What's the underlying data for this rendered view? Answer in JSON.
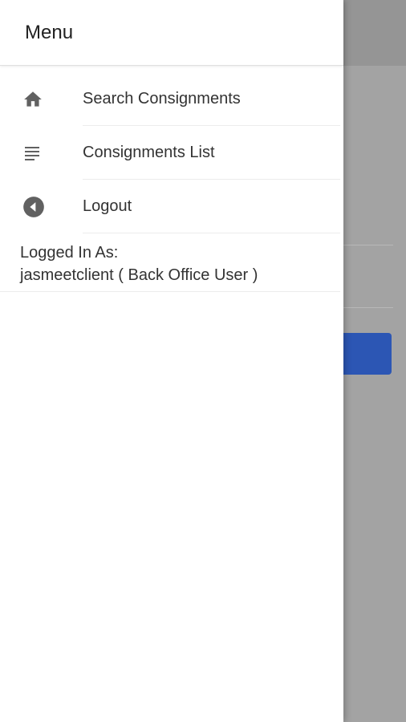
{
  "drawer": {
    "title": "Menu",
    "items": [
      {
        "label": "Search Consignments",
        "icon": "home-icon"
      },
      {
        "label": "Consignments List",
        "icon": "list-icon"
      },
      {
        "label": "Logout",
        "icon": "back-circle-icon"
      }
    ],
    "user": {
      "line1": "Logged In As:",
      "line2": "jasmeetclient ( Back Office User )"
    }
  },
  "colors": {
    "accent_button": "#2c56b4",
    "overlay": "#a3a3a3"
  }
}
